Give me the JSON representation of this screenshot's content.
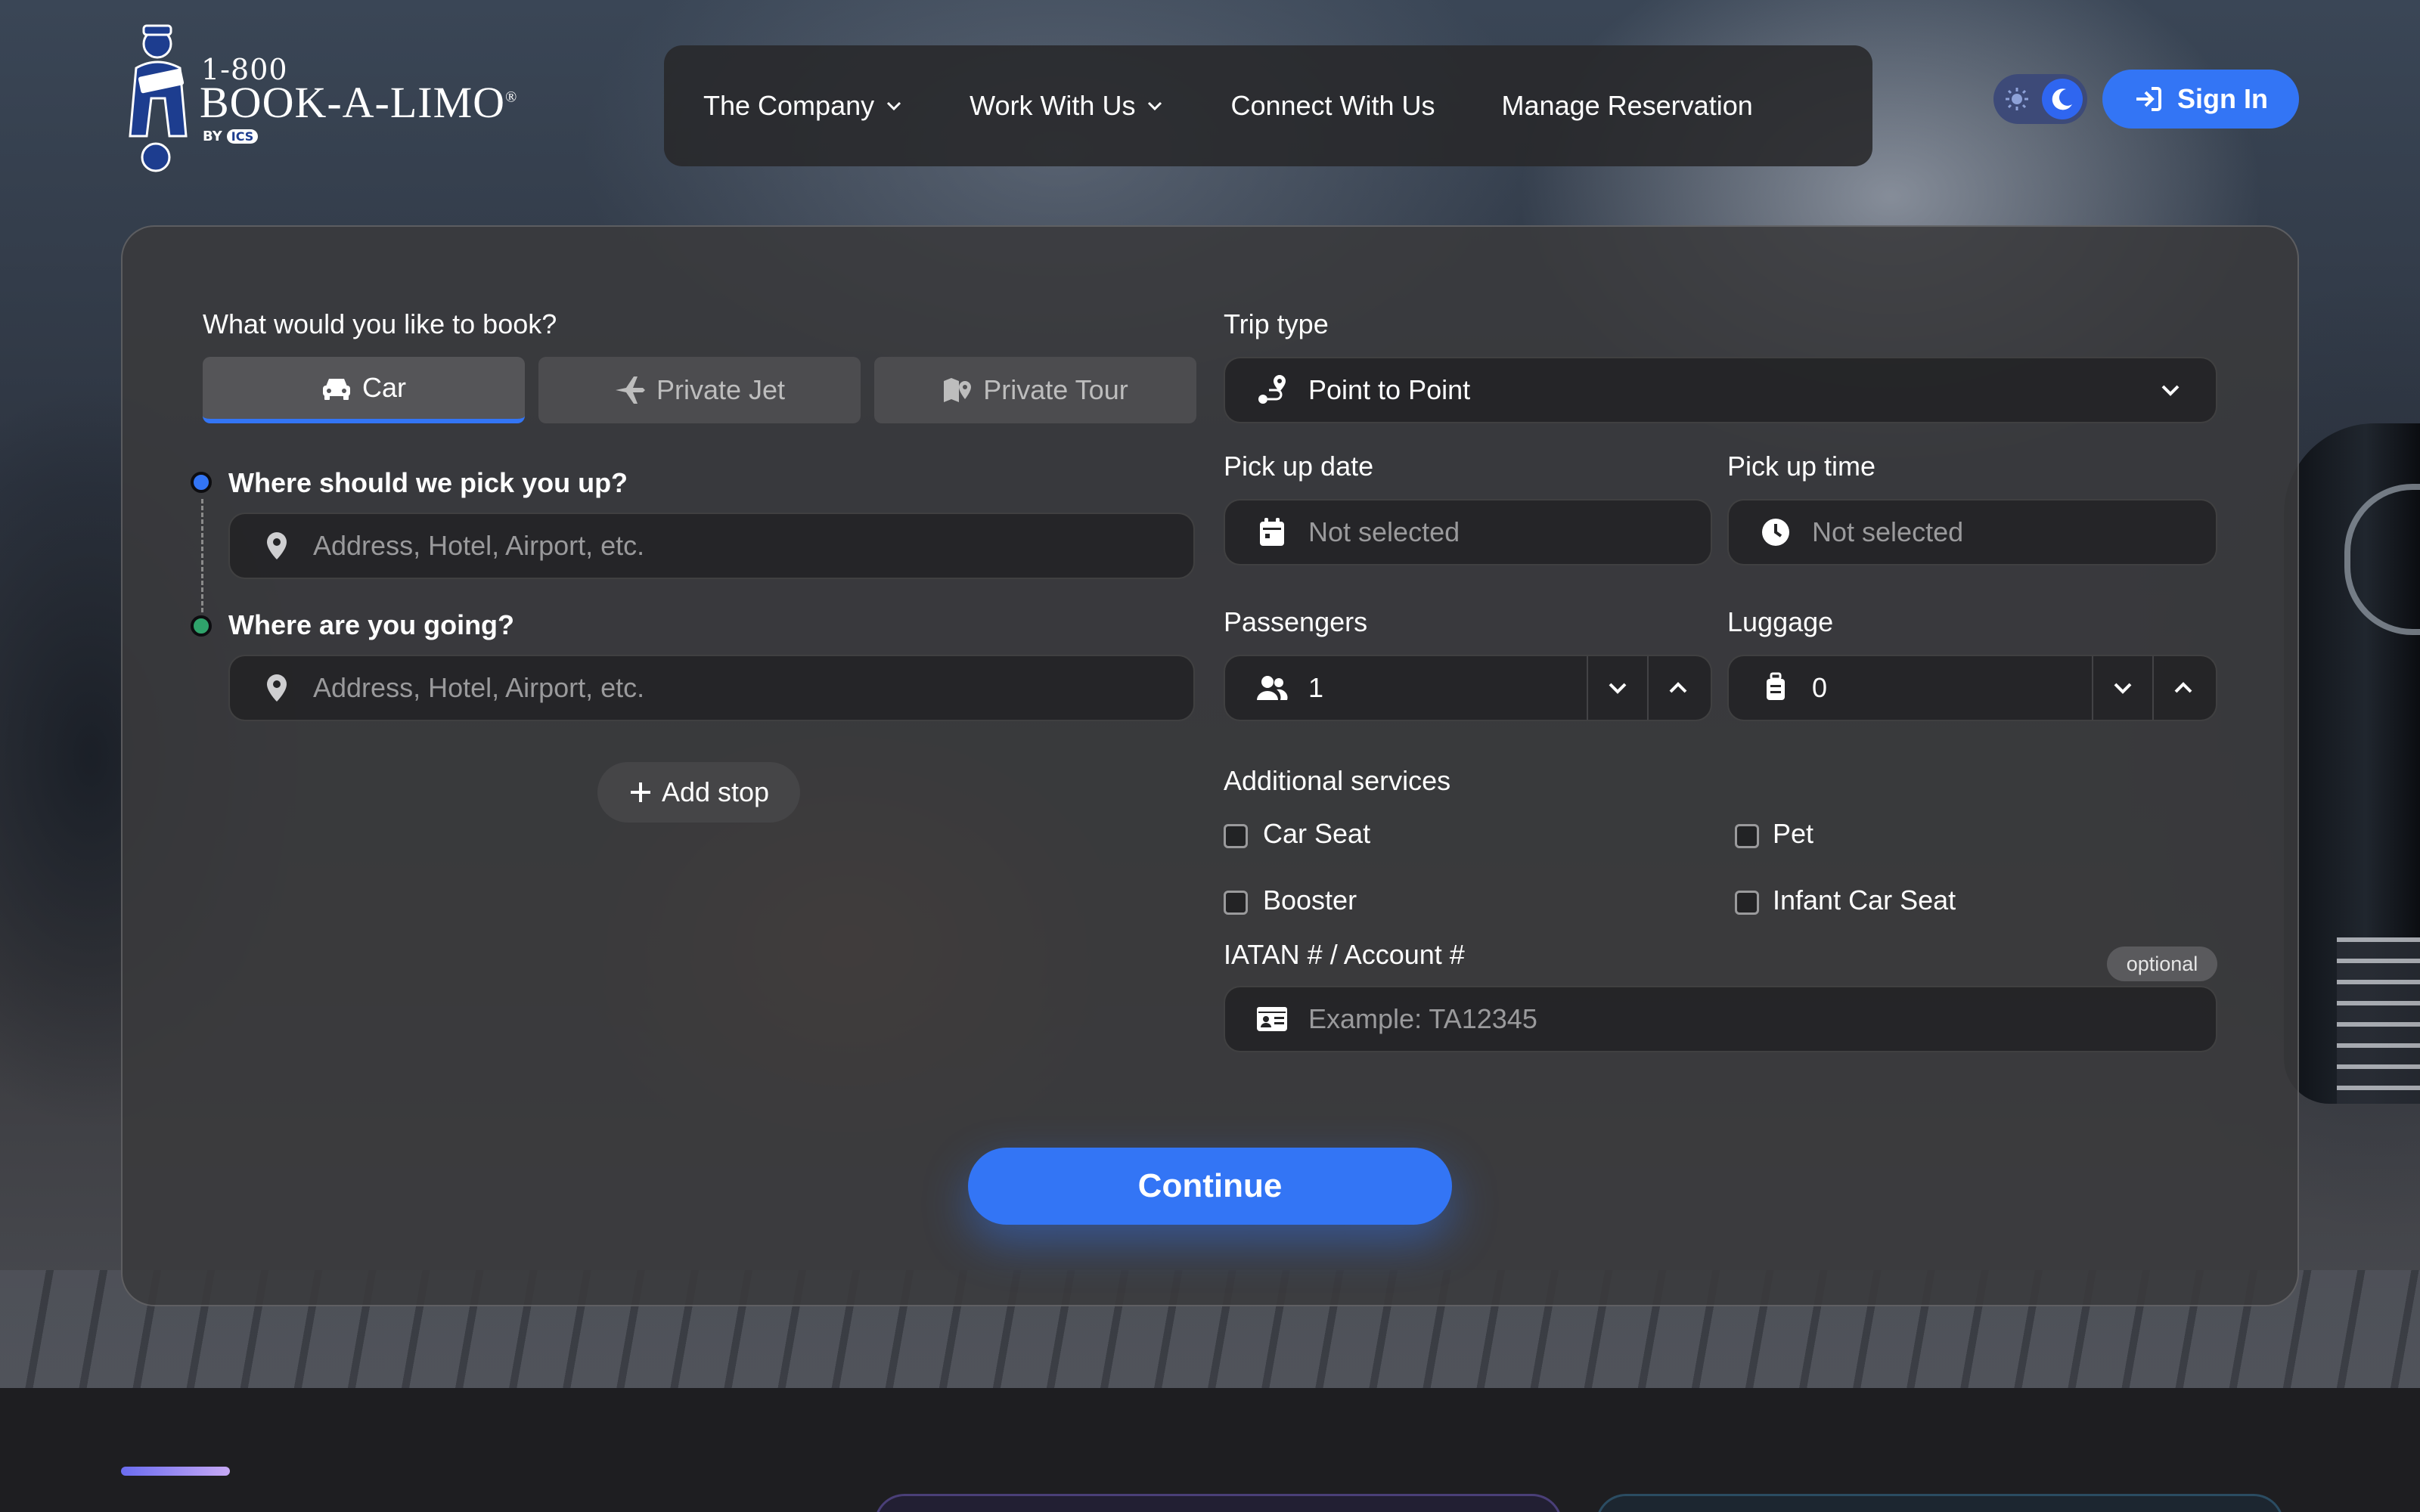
{
  "brand": {
    "line1": "1-800",
    "line2": "BOOK-A-LIMO",
    "registered": "®",
    "by_label": "BY",
    "by_mark": "ICS"
  },
  "nav": {
    "items": [
      {
        "label": "The Company",
        "has_dropdown": true
      },
      {
        "label": "Work With Us",
        "has_dropdown": true
      },
      {
        "label": "Connect With Us",
        "has_dropdown": false
      },
      {
        "label": "Manage Reservation",
        "has_dropdown": false
      }
    ],
    "signin_label": "Sign In",
    "theme_mode": "dark"
  },
  "booking": {
    "book_question": "What would you like to book?",
    "tabs": [
      {
        "label": "Car",
        "icon": "car-icon",
        "active": true
      },
      {
        "label": "Private Jet",
        "icon": "plane-icon",
        "active": false
      },
      {
        "label": "Private Tour",
        "icon": "map-pin-icon",
        "active": false
      }
    ],
    "pickup_label": "Where should we pick you up?",
    "pickup_placeholder": "Address, Hotel, Airport, etc.",
    "dropoff_label": "Where are you going?",
    "dropoff_placeholder": "Address, Hotel, Airport, etc.",
    "add_stop_label": "Add stop",
    "trip_type_label": "Trip type",
    "trip_type_value": "Point to Point",
    "pickup_date_label": "Pick up date",
    "pickup_date_value": "Not selected",
    "pickup_time_label": "Pick up time",
    "pickup_time_value": "Not selected",
    "passengers_label": "Passengers",
    "passengers_value": "1",
    "luggage_label": "Luggage",
    "luggage_value": "0",
    "additional_services_label": "Additional services",
    "services": [
      {
        "label": "Car Seat",
        "checked": false
      },
      {
        "label": "Pet",
        "checked": false
      },
      {
        "label": "Booster",
        "checked": false
      },
      {
        "label": "Infant Car Seat",
        "checked": false
      }
    ],
    "account_label": "IATAN # / Account #",
    "account_optional": "optional",
    "account_placeholder": "Example: TA12345",
    "continue_label": "Continue"
  },
  "colors": {
    "accent": "#3375f5",
    "pickup_dot": "#3375f5",
    "dropoff_dot": "#2fa36b"
  }
}
